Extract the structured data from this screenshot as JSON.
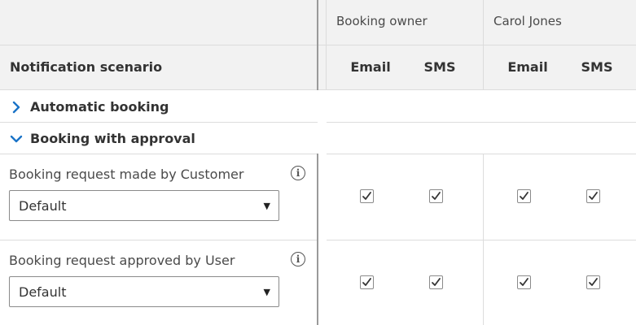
{
  "header": {
    "scenario_column": "Notification scenario",
    "groups": [
      {
        "name": "Booking owner",
        "email": "Email",
        "sms": "SMS"
      },
      {
        "name": "Carol Jones",
        "email": "Email",
        "sms": "SMS"
      }
    ]
  },
  "sections": [
    {
      "label": "Automatic booking",
      "expanded": false,
      "icon": "chevron-right-icon"
    },
    {
      "label": "Booking with approval",
      "expanded": true,
      "icon": "chevron-down-icon"
    }
  ],
  "scenarios": [
    {
      "title": "Booking request made by Customer",
      "select_value": "Default",
      "checks": {
        "owner_email": true,
        "owner_sms": true,
        "carol_email": true,
        "carol_sms": true
      }
    },
    {
      "title": "Booking request approved by User",
      "select_value": "Default",
      "checks": {
        "owner_email": true,
        "owner_sms": true,
        "carol_email": true,
        "carol_sms": true
      }
    }
  ],
  "colors": {
    "accent": "#1a73c7",
    "header_bg": "#f2f2f2",
    "border": "#dcdcdc"
  }
}
